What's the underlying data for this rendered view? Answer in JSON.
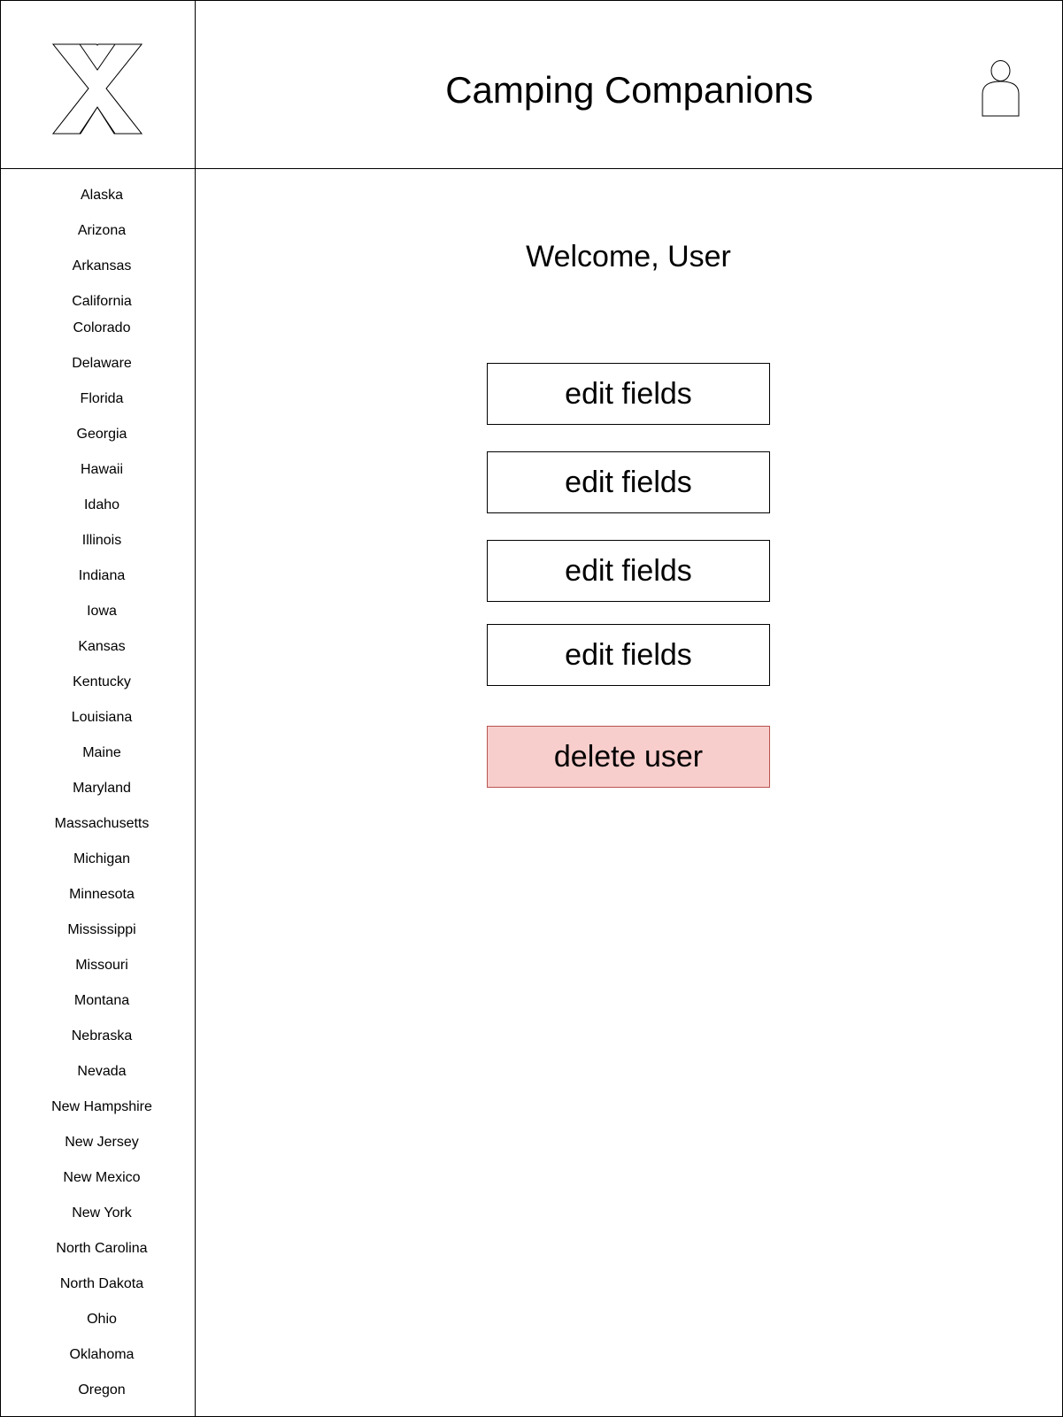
{
  "header": {
    "title": "Camping Companions",
    "logo_icon": "x-logo-icon",
    "profile_icon": "user-avatar-icon"
  },
  "sidebar": {
    "items": [
      "Alaska",
      "Arizona",
      "Arkansas",
      "California",
      "Colorado",
      "Delaware",
      "Florida",
      "Georgia",
      "Hawaii",
      "Idaho",
      "Illinois",
      "Indiana",
      "Iowa",
      "Kansas",
      "Kentucky",
      "Louisiana",
      "Maine",
      "Maryland",
      "Massachusetts",
      "Michigan",
      "Minnesota",
      "Mississippi",
      "Missouri",
      "Montana",
      "Nebraska",
      "Nevada",
      "New Hampshire",
      "New Jersey",
      "New Mexico",
      "New York",
      "North Carolina",
      "North Dakota",
      "Ohio",
      "Oklahoma",
      "Oregon"
    ]
  },
  "main": {
    "welcome": "Welcome, User",
    "edit_buttons": [
      "edit fields",
      "edit fields",
      "edit fields",
      "edit fields"
    ],
    "delete_button": "delete user"
  },
  "colors": {
    "danger_fill": "#f8cecc",
    "danger_border": "#b85450"
  }
}
